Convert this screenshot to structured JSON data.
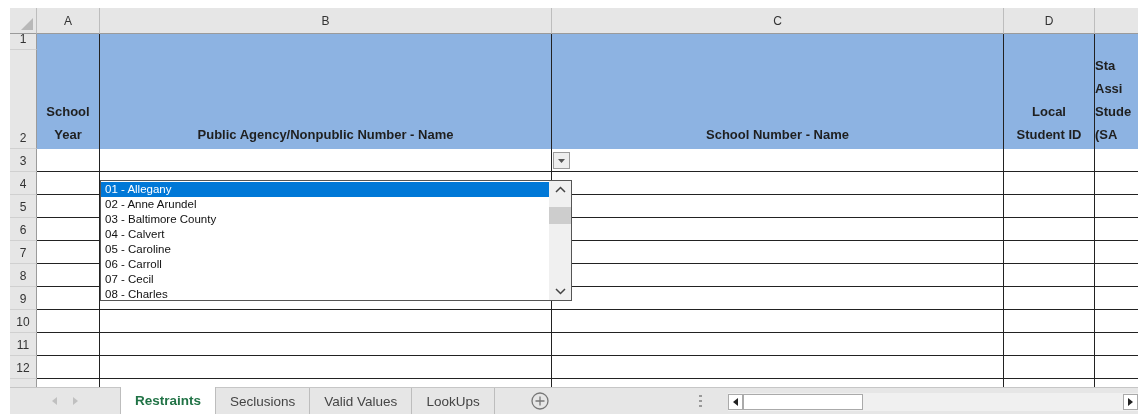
{
  "columns": [
    {
      "letter": "A"
    },
    {
      "letter": "B"
    },
    {
      "letter": "C"
    },
    {
      "letter": "D"
    }
  ],
  "header_rows": [
    "1",
    "2"
  ],
  "header_cells": [
    {
      "lines": [
        "School",
        "Year"
      ]
    },
    {
      "lines": [
        "Public Agency/Nonpublic Number - Name"
      ]
    },
    {
      "lines": [
        "School Number - Name"
      ]
    },
    {
      "lines": [
        "Local",
        "Student ID"
      ]
    },
    {
      "lines": [
        "Sta",
        "Assi",
        "Stude",
        "(SA"
      ]
    }
  ],
  "rows": [
    "3",
    "4",
    "5",
    "6",
    "7",
    "8",
    "9",
    "10",
    "11",
    "12"
  ],
  "dropdown": {
    "items": [
      {
        "label": "01 - Allegany",
        "selected": true
      },
      {
        "label": "02 - Anne Arundel",
        "selected": false
      },
      {
        "label": "03 - Baltimore County",
        "selected": false
      },
      {
        "label": "04 - Calvert",
        "selected": false
      },
      {
        "label": "05 - Caroline",
        "selected": false
      },
      {
        "label": "06 - Carroll",
        "selected": false
      },
      {
        "label": "07 - Cecil",
        "selected": false
      },
      {
        "label": "08 - Charles",
        "selected": false
      }
    ]
  },
  "sheet_tabs": [
    {
      "label": "Restraints",
      "selected": true
    },
    {
      "label": "Seclusions",
      "selected": false
    },
    {
      "label": "Valid Values",
      "selected": false
    },
    {
      "label": "LookUps",
      "selected": false
    }
  ]
}
